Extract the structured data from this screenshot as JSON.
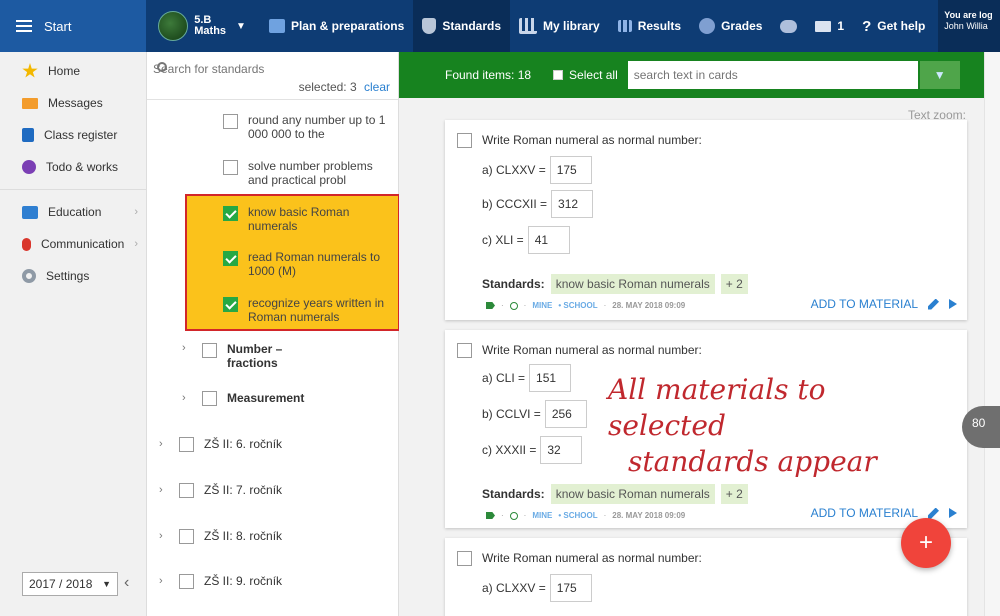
{
  "topbar": {
    "start_label": "Start",
    "class_label_1": "5.B",
    "class_label_2": "Maths",
    "nav": [
      {
        "label": "Plan & preparations",
        "icon": "briefcase-icon"
      },
      {
        "label": "Standards",
        "icon": "shield-icon"
      },
      {
        "label": "My library",
        "icon": "library-icon"
      },
      {
        "label": "Results",
        "icon": "bar-chart-icon"
      },
      {
        "label": "Grades",
        "icon": "grades-icon"
      }
    ],
    "mail_count": "1",
    "help_label": "Get help",
    "user_line1": "You are log",
    "user_line2": "John Willia"
  },
  "leftnav": {
    "items": [
      {
        "label": "Home",
        "icon": "star-icon"
      },
      {
        "label": "Messages",
        "icon": "envelope-icon"
      },
      {
        "label": "Class register",
        "icon": "register-book-icon"
      },
      {
        "label": "Todo & works",
        "icon": "todo-icon"
      },
      {
        "label": "Education",
        "icon": "education-book-icon"
      },
      {
        "label": "Communication",
        "icon": "communication-icon"
      },
      {
        "label": "Settings",
        "icon": "gear-icon"
      }
    ],
    "year": "2017 / 2018"
  },
  "standards": {
    "search_placeholder": "Search for standards",
    "selected_text": "selected: 3",
    "clear_label": "clear",
    "items": [
      {
        "text": "round any number up to 1 000 000 to the",
        "checked": false
      },
      {
        "text": "solve number problems and practical probl",
        "checked": false
      },
      {
        "text": "know basic Roman numerals",
        "checked": true
      },
      {
        "text": "read Roman numerals to 1000 (M)",
        "checked": true
      },
      {
        "text": "recognize years written in Roman numerals",
        "checked": true
      }
    ],
    "tree": [
      {
        "label": "Number – fractions"
      },
      {
        "label": "Measurement"
      },
      {
        "label": "ZŠ II: 6. ročník"
      },
      {
        "label": "ZŠ II: 7. ročník"
      },
      {
        "label": "ZŠ II: 8. ročník"
      },
      {
        "label": "ZŠ II: 9. ročník"
      }
    ]
  },
  "toolbar": {
    "found_text": "Found items: 18",
    "select_all_label": "Select all",
    "search_placeholder": "search text in cards",
    "text_zoom_label": "Text zoom:"
  },
  "cards": [
    {
      "title": "Write Roman numeral as normal number:",
      "rows": [
        {
          "q": "a) CLXXV =",
          "a": "175"
        },
        {
          "q": "b) CCCXII =",
          "a": "312"
        },
        {
          "q": "c) XLI =",
          "a": "41"
        }
      ],
      "standards_label": "Standards:",
      "standard": "know basic Roman numerals",
      "more": "+ 2",
      "meta_owner": "MINE",
      "meta_scope": "• SCHOOL",
      "meta_date": "28. MAY 2018 09:09",
      "action": "ADD TO MATERIAL"
    },
    {
      "title": "Write Roman numeral as normal number:",
      "rows": [
        {
          "q": "a) CLI =",
          "a": "151"
        },
        {
          "q": "b) CCLVI =",
          "a": "256"
        },
        {
          "q": "c) XXXII =",
          "a": "32"
        }
      ],
      "standards_label": "Standards:",
      "standard": "know basic Roman numerals",
      "more": "+ 2",
      "meta_owner": "MINE",
      "meta_scope": "• SCHOOL",
      "meta_date": "28. MAY 2018 09:09",
      "action": "ADD TO MATERIAL"
    },
    {
      "title": "Write Roman numeral as normal number:",
      "rows": [
        {
          "q": "a) CLXXV =",
          "a": "175"
        }
      ]
    }
  ],
  "annotation": {
    "line1": "All materials to selected",
    "line2": "standards appear"
  },
  "fab_label": "+",
  "side_badge": "80",
  "colors": {
    "topbar": "#0e3c74",
    "greenbar": "#17831f",
    "highlight": "#fbc21b",
    "highlight_border": "#d2262a",
    "annotation": "#c0282e",
    "fab": "#f0443b"
  }
}
